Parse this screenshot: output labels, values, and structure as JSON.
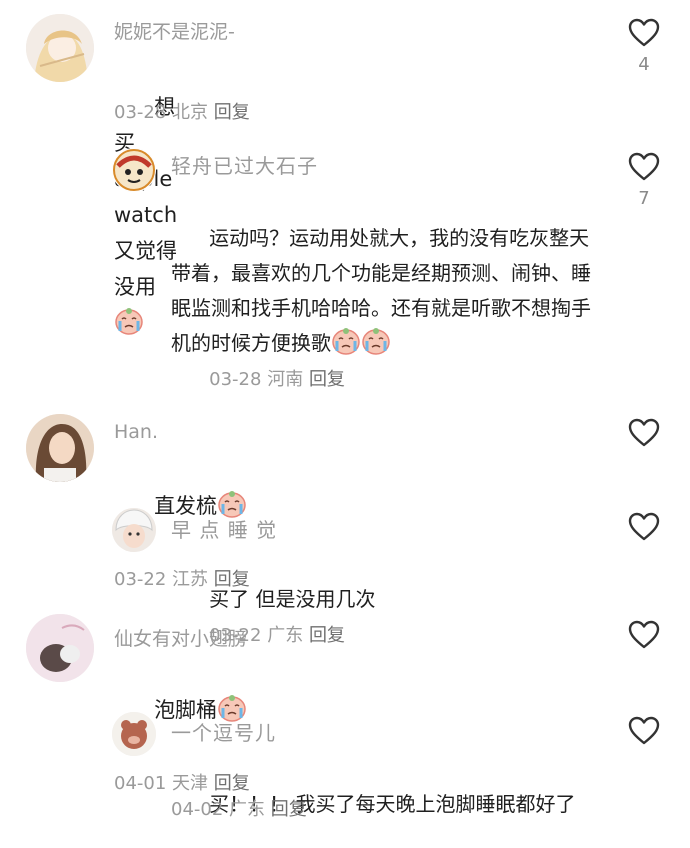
{
  "comments": [
    {
      "username": "妮妮不是泥泥-",
      "text": "想买 apple watch 又觉得没用",
      "emojis": [
        "crying-face-emoji"
      ],
      "date": "03-28",
      "location": "北京",
      "reply_label": "回复",
      "likes": "4",
      "replies": [
        {
          "username": "轻舟已过大石子",
          "text": "运动吗？运动用处就大，我的没有吃灰整天带着，最喜欢的几个功能是经期预测、闹钟、睡眠监测和找手机哈哈哈。还有就是听歌不想掏手机的时候方便换歌",
          "emojis": [
            "crying-face-emoji",
            "crying-face-emoji"
          ],
          "date": "03-28",
          "location": "河南",
          "reply_label": "回复",
          "likes": "7"
        }
      ]
    },
    {
      "username": "Han.",
      "text": "直发梳",
      "emojis": [
        "crying-face-emoji"
      ],
      "date": "03-22",
      "location": "江苏",
      "reply_label": "回复",
      "likes": "",
      "replies": [
        {
          "username": "早 点 睡 觉",
          "text": "买了 但是没用几次",
          "emojis": [],
          "date": "03-22",
          "location": "广东",
          "reply_label": "回复",
          "likes": ""
        }
      ]
    },
    {
      "username": "仙女有对小翅膀",
      "text": "泡脚桶",
      "emojis": [
        "crying-face-emoji"
      ],
      "date": "04-01",
      "location": "天津",
      "reply_label": "回复",
      "likes": "",
      "replies": [
        {
          "username": "一个逗号儿",
          "text": "买！！！ 我买了每天晚上泡脚睡眠都好了",
          "emojis": [],
          "date": "04-02",
          "location": "广东",
          "reply_label": "回复",
          "likes": ""
        }
      ]
    }
  ],
  "icons": {
    "like": "heart-outline-icon"
  },
  "colors": {
    "meta": "#9a9a9a",
    "text": "#1f1f1f",
    "heart": "#333333"
  }
}
